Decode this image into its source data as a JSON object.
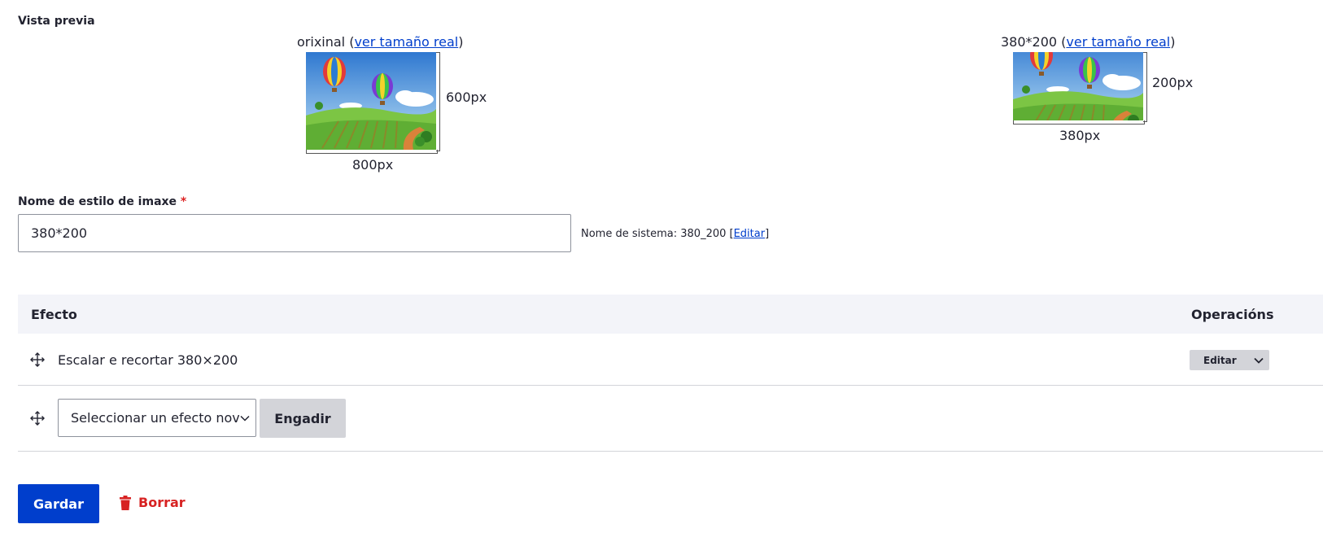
{
  "preview": {
    "heading": "Vista previa",
    "original": {
      "caption_prefix": "orixinal (",
      "link": "ver tamaño real",
      "caption_suffix": ")",
      "height_label": "600px",
      "width_label": "800px"
    },
    "derived": {
      "caption_prefix": "380*200 (",
      "link": "ver tamaño real",
      "caption_suffix": ")",
      "height_label": "200px",
      "width_label": "380px"
    }
  },
  "style_name": {
    "label": "Nome de estilo de imaxe",
    "required_mark": "*",
    "value": "380*200",
    "machine_prefix": "Nome de sistema: 380_200 [",
    "machine_link": "Editar",
    "machine_suffix": "]"
  },
  "effects_table": {
    "col_effect": "Efecto",
    "col_operations": "Operacións",
    "rows": [
      {
        "effect": "Escalar e recortar 380×200",
        "operation": "Editar"
      }
    ],
    "new_effect": {
      "select_value": "Seleccionar un efecto novo",
      "add_label": "Engadir"
    }
  },
  "actions": {
    "save_label": "Gardar",
    "delete_label": "Borrar"
  },
  "colors": {
    "primary": "#003ecc",
    "danger": "#d72222",
    "table_header": "#f3f4f9"
  }
}
